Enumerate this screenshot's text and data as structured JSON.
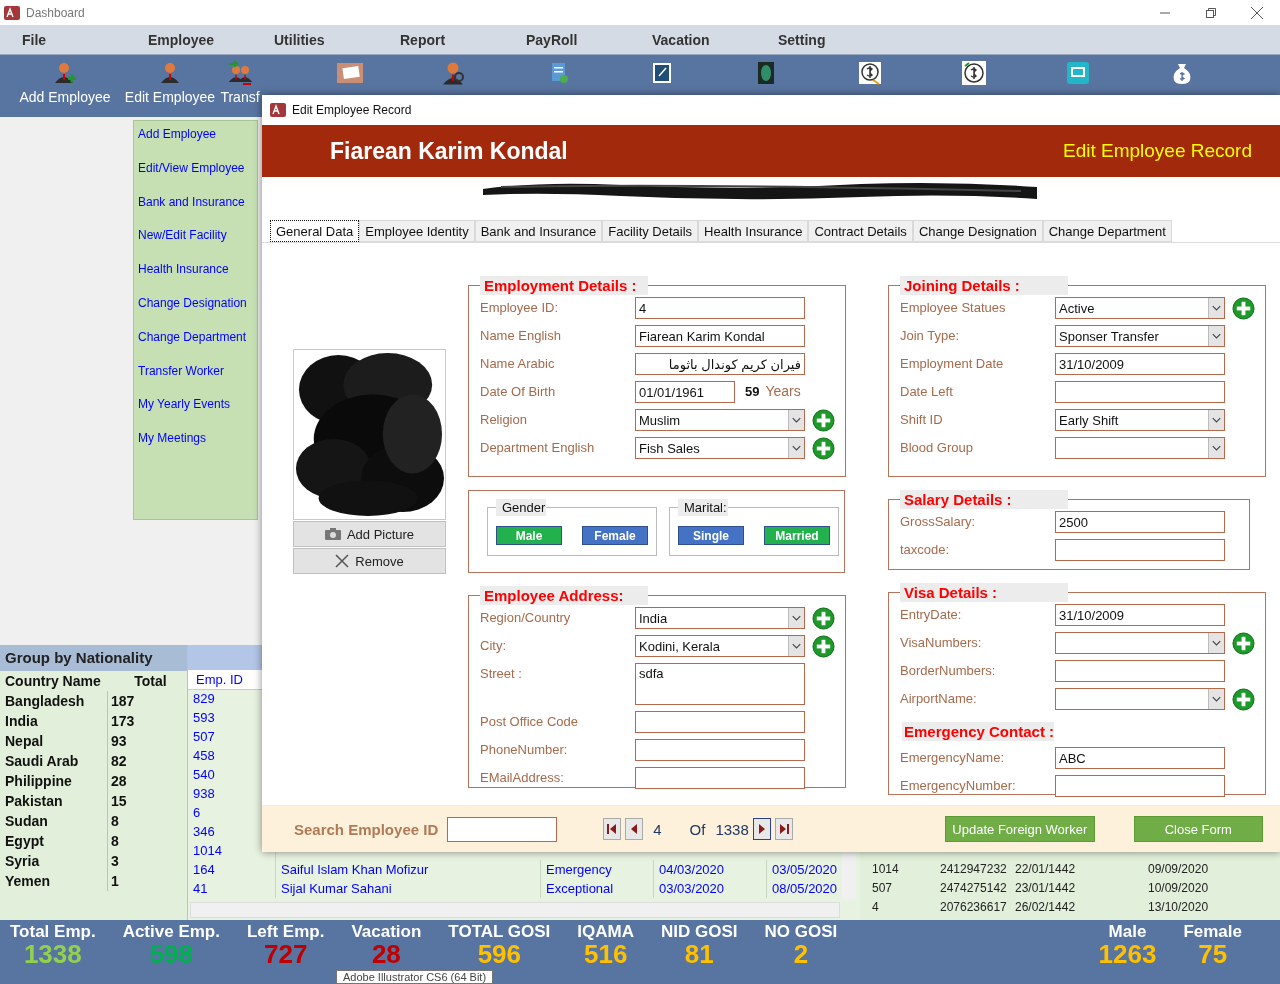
{
  "window": {
    "title": "Dashboard"
  },
  "menu": [
    "File",
    "Employee",
    "Utilities",
    "Report",
    "PayRoll",
    "Vacation",
    "Setting"
  ],
  "toolbar": [
    {
      "kind": "labeled",
      "label": "Add Employee"
    },
    {
      "kind": "labeled",
      "label": "Edit Employee"
    },
    {
      "kind": "labeled",
      "label": "Transf"
    },
    {
      "kind": "icon"
    },
    {
      "kind": "icon"
    },
    {
      "kind": "icon"
    },
    {
      "kind": "icon"
    },
    {
      "kind": "icon"
    },
    {
      "kind": "icon"
    },
    {
      "kind": "icon"
    },
    {
      "kind": "icon"
    },
    {
      "kind": "icon"
    }
  ],
  "sidebar": {
    "items": [
      "Add Employee",
      "Edit/View Employee",
      "Bank and Insurance",
      "New/Edit Facility",
      "Health Insurance",
      "Change Designation",
      "Change Department",
      "Transfer Worker",
      "My Yearly Events",
      "My Meetings"
    ]
  },
  "nationality": {
    "title": "Group by Nationality",
    "columns": [
      "Country Name",
      "Total"
    ],
    "rows": [
      [
        "Bangladesh",
        "187"
      ],
      [
        "India",
        "173"
      ],
      [
        "Nepal",
        "93"
      ],
      [
        "Saudi Arab",
        "82"
      ],
      [
        "Philippine",
        "28"
      ],
      [
        "Pakistan",
        "15"
      ],
      [
        "Sudan",
        "8"
      ],
      [
        "Egypt",
        "8"
      ],
      [
        "Syria",
        "3"
      ],
      [
        "Yemen",
        "1"
      ]
    ]
  },
  "grid": {
    "columns": [
      "Emp. ID"
    ],
    "rows": [
      [
        "829"
      ],
      [
        "593"
      ],
      [
        "507"
      ],
      [
        "458"
      ],
      [
        "540"
      ],
      [
        "938"
      ],
      [
        "6"
      ],
      [
        "346"
      ],
      [
        "1014"
      ],
      [
        "164",
        "Saiful Islam Khan Mofizur",
        "Emergency",
        "04/03/2020",
        "03/05/2020"
      ],
      [
        "41",
        "Sijal Kumar Sahani",
        "Exceptional",
        "03/03/2020",
        "08/05/2020"
      ]
    ]
  },
  "grid_right": {
    "rows": [
      [
        "1014",
        "2412947232",
        "22/01/1442",
        "09/09/2020"
      ],
      [
        "507",
        "2474275142",
        "23/01/1442",
        "10/09/2020"
      ],
      [
        "4",
        "2076236617",
        "26/02/1442",
        "13/10/2020"
      ]
    ]
  },
  "stats": [
    {
      "label": "Total Emp.",
      "value": "1338",
      "color": "#92d050"
    },
    {
      "label": "Active Emp.",
      "value": "598",
      "color": "#00b050"
    },
    {
      "label": "Left Emp.",
      "value": "727",
      "color": "#c00000"
    },
    {
      "label": "Vacation",
      "value": "28",
      "color": "#c00000"
    },
    {
      "label": "TOTAL GOSI",
      "value": "596",
      "color": "#ffc000"
    },
    {
      "label": "IQAMA",
      "value": "516",
      "color": "#ffc000"
    },
    {
      "label": "NID GOSI",
      "value": "81",
      "color": "#ffc000"
    },
    {
      "label": "NO GOSI",
      "value": "2",
      "color": "#ffc000"
    }
  ],
  "gender_stats": [
    {
      "label": "Male",
      "value": "1263",
      "color": "#ffc000"
    },
    {
      "label": "Female",
      "value": "75",
      "color": "#ffc000"
    }
  ],
  "tooltip": {
    "text": "Adobe Illustrator CS6 (64 Bit)"
  },
  "dialog": {
    "title": "Edit Employee Record",
    "name": "Fiarean Karim Kondal",
    "heading": "Edit Employee Record",
    "tabs": [
      {
        "label": "General Data",
        "selected": true
      },
      {
        "label": "Employee Identity",
        "selected": false
      },
      {
        "label": "Bank and Insurance",
        "selected": false
      },
      {
        "label": "Facility Details",
        "selected": false
      },
      {
        "label": "Health Insurance",
        "selected": false
      },
      {
        "label": "Contract Details",
        "selected": false
      },
      {
        "label": "Change Designation",
        "selected": false
      },
      {
        "label": "Change Department",
        "selected": false
      }
    ],
    "photo": {
      "kind": "picture",
      "add_button": "Add Picture",
      "remove_button": "Remove"
    },
    "employment": {
      "legend": "Employment Details :",
      "fields": [
        {
          "label": "Employee ID:",
          "kind": "text",
          "value": "4",
          "add": false
        },
        {
          "label": "Name English",
          "kind": "text",
          "value": "Fiarean Karim Kondal",
          "add": false
        },
        {
          "label": "Name Arabic",
          "kind": "text",
          "value": "فيران كريم كوندال باثوما",
          "add": false
        },
        {
          "label": "Date Of Birth",
          "kind": "age",
          "value": "01/01/1961",
          "age": "59",
          "unit": "Years",
          "add": false
        },
        {
          "label": "Religion",
          "kind": "select",
          "value": "Muslim",
          "add": true
        },
        {
          "label": "Department English",
          "kind": "select",
          "value": "Fish Sales",
          "add": true
        }
      ]
    },
    "gender": {
      "legend": "Gender",
      "options": [
        {
          "label": "Male",
          "selected": true
        },
        {
          "label": "Female",
          "selected": false
        }
      ]
    },
    "marital": {
      "legend": "Marital:",
      "options": [
        {
          "label": "Single",
          "selected": false
        },
        {
          "label": "Married",
          "selected": true
        }
      ]
    },
    "address": {
      "legend": "Employee Address:",
      "fields": [
        {
          "label": "Region/Country",
          "kind": "select",
          "value": "India",
          "add": true
        },
        {
          "label": "City:",
          "kind": "select",
          "value": "Kodini, Kerala",
          "add": true
        },
        {
          "label": "Street :",
          "kind": "area",
          "value": "sdfa",
          "add": false
        },
        {
          "label": "Post Office Code",
          "kind": "text",
          "add": false
        },
        {
          "label": "PhoneNumber:",
          "kind": "text",
          "add": false
        },
        {
          "label": "EMailAddress:",
          "kind": "text",
          "add": false
        }
      ]
    },
    "joining": {
      "legend": "Joining Details  :",
      "fields": [
        {
          "label": "Employee Statues",
          "kind": "select",
          "value": "Active",
          "add": true
        },
        {
          "label": "Join Type:",
          "kind": "select",
          "value": "Sponser Transfer",
          "add": false
        },
        {
          "label": "Employment Date",
          "kind": "text",
          "value": "31/10/2009",
          "add": false
        },
        {
          "label": "Date Left",
          "kind": "text",
          "add": false
        },
        {
          "label": "Shift ID",
          "kind": "select",
          "value": "Early Shift",
          "add": false
        },
        {
          "label": "Blood Group",
          "kind": "select",
          "add": false
        }
      ]
    },
    "salary": {
      "legend": "Salary Details :",
      "fields": [
        {
          "label": "GrossSalary:",
          "kind": "text",
          "value": "2500",
          "add": false
        },
        {
          "label": "taxcode:",
          "kind": "text",
          "add": false
        }
      ]
    },
    "visa": {
      "legend": "Visa Details :",
      "fields": [
        {
          "label": "EntryDate:",
          "kind": "text",
          "value": "31/10/2009",
          "add": false
        },
        {
          "label": "VisaNumbers:",
          "kind": "select",
          "add": true
        },
        {
          "label": "BorderNumbers:",
          "kind": "text",
          "add": false
        },
        {
          "label": "AirportName:",
          "kind": "select",
          "add": true
        }
      ]
    },
    "emergency": {
      "heading": "Emergency Contact :",
      "fields": [
        {
          "label": "EmergencyName:",
          "kind": "text",
          "value": "ABC",
          "add": false
        },
        {
          "label": "EmergencyNumber:",
          "kind": "text",
          "add": false
        }
      ]
    },
    "footer": {
      "search_label": "Search Employee ID",
      "current": "4",
      "of": "Of",
      "total": "1338",
      "update_button": "Update Foreign Worker",
      "close_button": "Close Form"
    }
  }
}
